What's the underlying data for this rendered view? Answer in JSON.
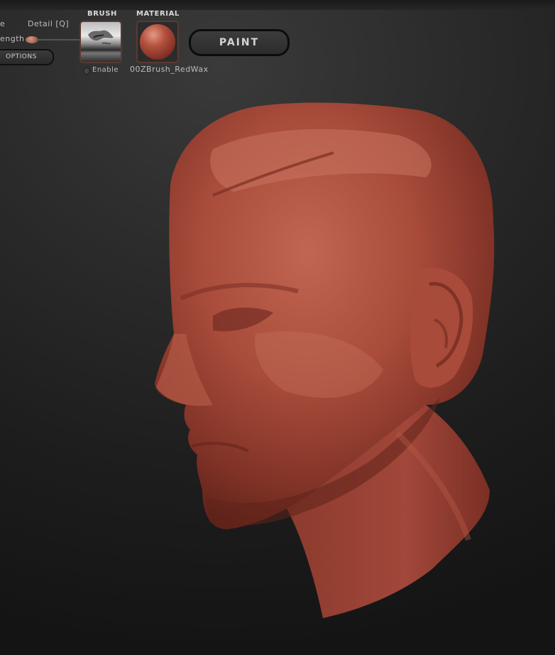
{
  "toolbar": {
    "left_cut_label": "e",
    "detail_label": "Detail [Q]",
    "strength_label": "ength",
    "options_label": "OPTIONS",
    "brush_heading": "BRUSH",
    "material_heading": "MATERIAL",
    "enable_label": "Enable",
    "material_name": "00ZBrush_RedWax",
    "paint_label": "PAINT"
  },
  "colors": {
    "material": "#b0503e",
    "background": "#2b2b2b"
  },
  "icons": {
    "brush": "brush-alpha-thumbnail",
    "material": "redwax-sphere"
  }
}
